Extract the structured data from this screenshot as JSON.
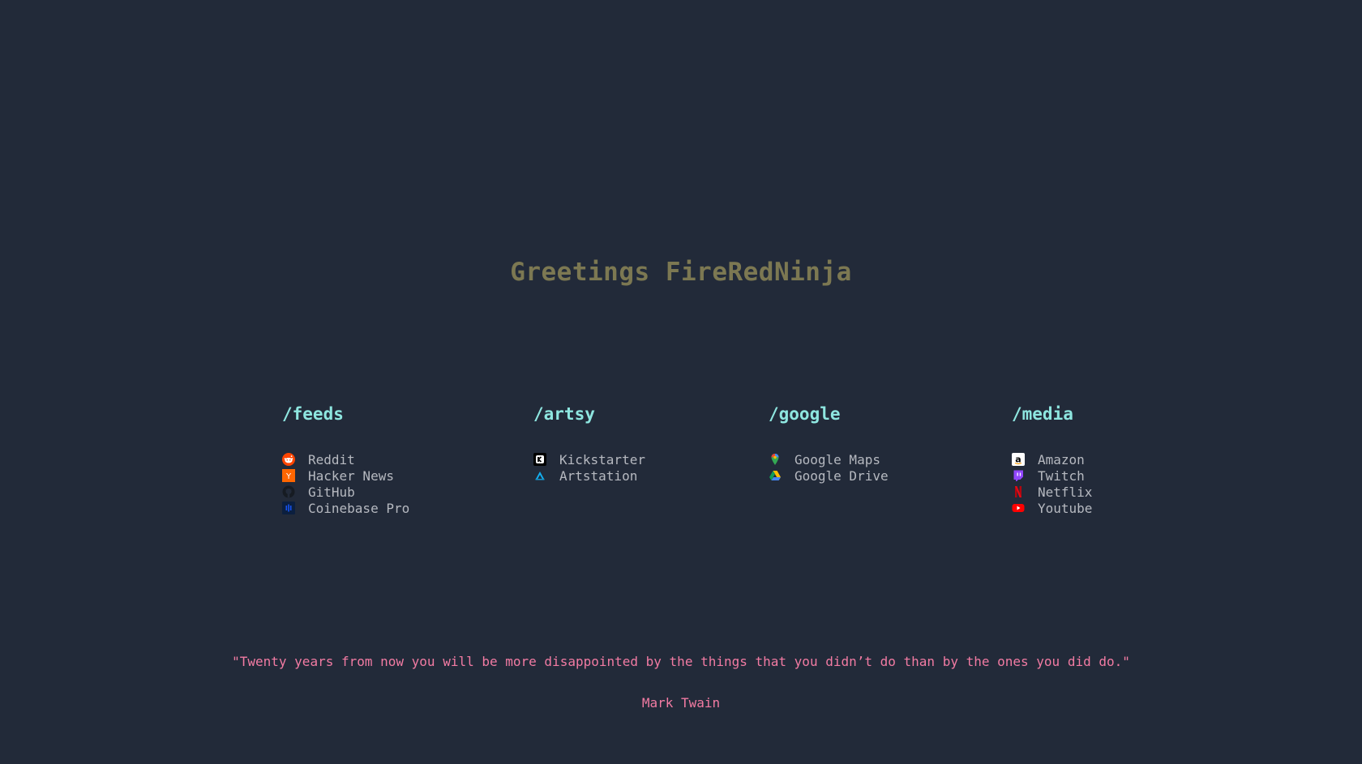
{
  "greeting": "Greetings FireRedNinja",
  "columns": [
    {
      "title": "/feeds",
      "links": [
        {
          "label": "Reddit",
          "icon": "reddit-icon",
          "color": "#ff4500"
        },
        {
          "label": "Hacker News",
          "icon": "hacker-news-icon",
          "color": "#ff6600"
        },
        {
          "label": "GitHub",
          "icon": "github-icon",
          "color": "#181d26"
        },
        {
          "label": "Coinebase Pro",
          "icon": "coinbase-pro-icon",
          "color": "#1652f0"
        }
      ]
    },
    {
      "title": "/artsy",
      "links": [
        {
          "label": "Kickstarter",
          "icon": "kickstarter-icon",
          "color": "#000000"
        },
        {
          "label": "Artstation",
          "icon": "artstation-icon",
          "color": "#13aff0"
        }
      ]
    },
    {
      "title": "/google",
      "links": [
        {
          "label": "Google Maps",
          "icon": "google-maps-icon",
          "color": "#34a853"
        },
        {
          "label": "Google Drive",
          "icon": "google-drive-icon",
          "color": "#fbbc04"
        }
      ]
    },
    {
      "title": "/media",
      "links": [
        {
          "label": "Amazon",
          "icon": "amazon-icon",
          "color": "#ffffff"
        },
        {
          "label": "Twitch",
          "icon": "twitch-icon",
          "color": "#9146ff"
        },
        {
          "label": "Netflix",
          "icon": "netflix-icon",
          "color": "#e50914"
        },
        {
          "label": "Youtube",
          "icon": "youtube-icon",
          "color": "#ff0000"
        }
      ]
    }
  ],
  "quote": {
    "text": "\"Twenty years from now you will be more disappointed by the things that you didn’t do than by the ones you did do.\"",
    "author": "Mark Twain"
  },
  "colors": {
    "background": "#222a39",
    "greeting": "#7c7852",
    "heading": "#8ee6e0",
    "link": "#b6b9c0",
    "quote": "#f27ba3"
  }
}
